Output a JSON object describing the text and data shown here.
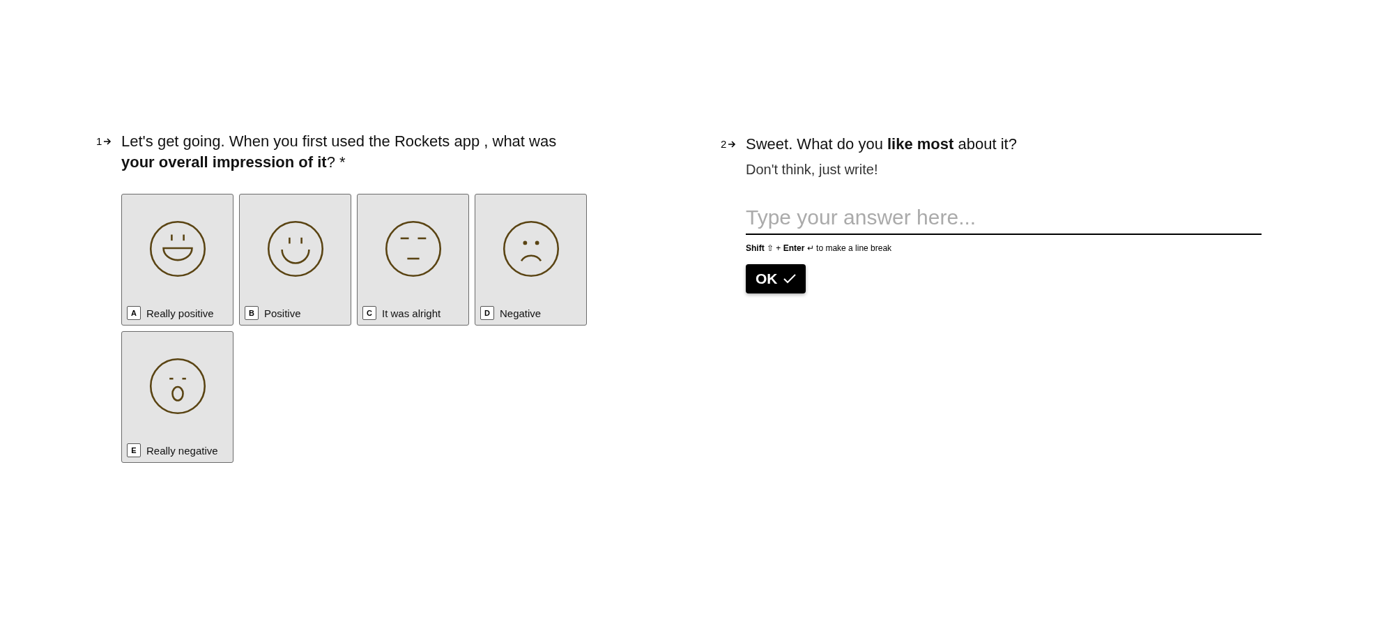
{
  "questions": [
    {
      "kind": "choice",
      "number": "1",
      "text": "Let's get going. When you first used the Rockets app , what was **your overall impression of it**? *",
      "options": [
        {
          "key": "A",
          "label": "Really positive",
          "kind": "laugh",
          "selected": false
        },
        {
          "key": "B",
          "label": "Positive",
          "kind": "smile",
          "selected": false
        },
        {
          "key": "C",
          "label": "It was alright",
          "kind": "meh",
          "selected": false
        },
        {
          "key": "D",
          "label": "Negative",
          "kind": "frown",
          "selected": false
        },
        {
          "key": "E",
          "label": "Really negative",
          "kind": "shock",
          "selected": false
        }
      ]
    },
    {
      "kind": "text",
      "number": "2",
      "text": "Sweet. What do you **like most** about it?",
      "description": "Don't think, just write!",
      "placeholder": "Type your answer here...",
      "hint": "**Shift** ⇧ + **Enter** ↵ to make a line break",
      "button": "OK"
    }
  ]
}
